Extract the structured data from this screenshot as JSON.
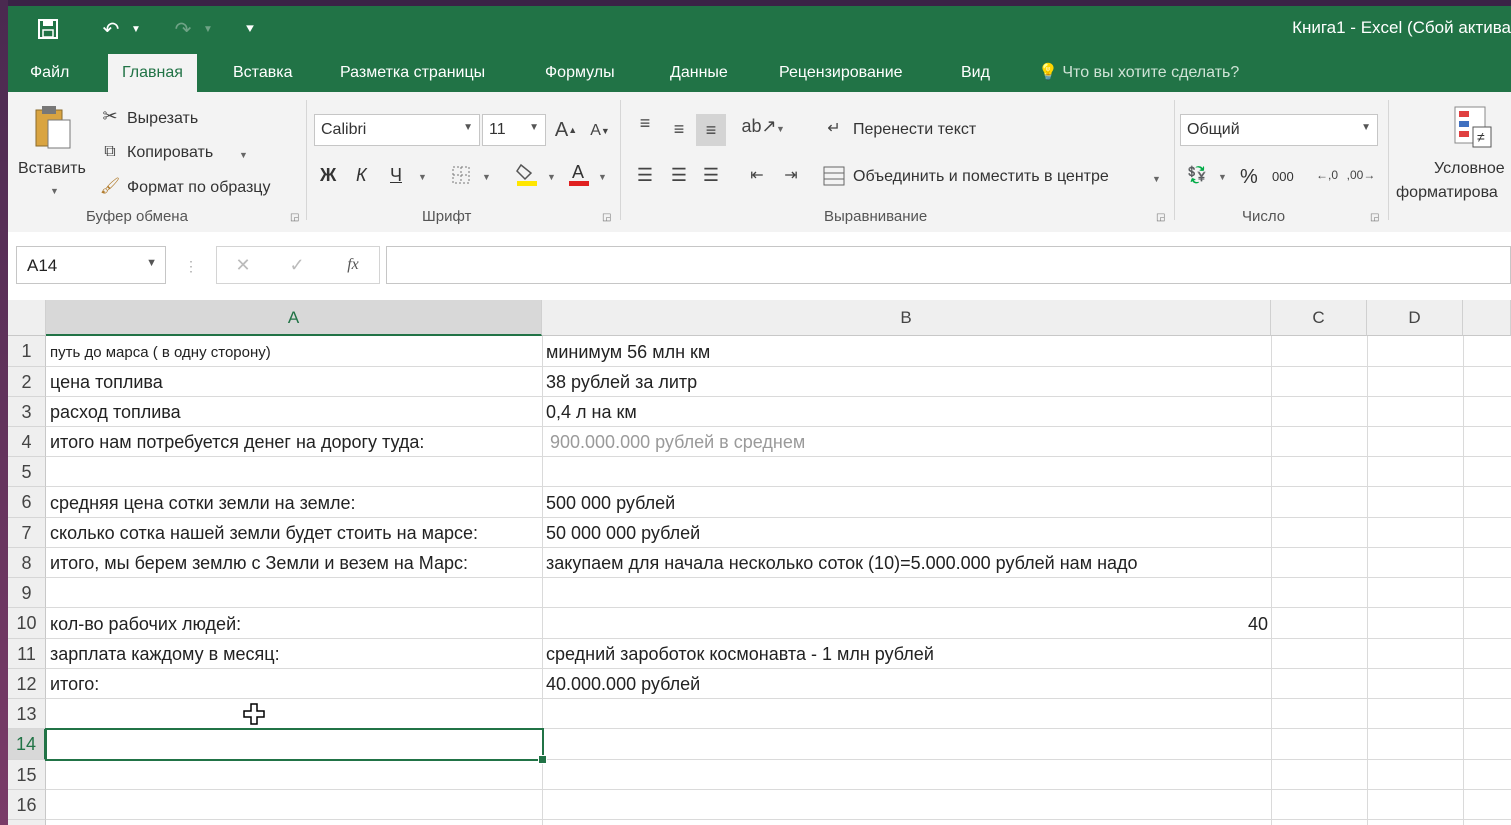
{
  "title": "Книга1 - Excel (Сбой актива",
  "tabs": [
    "Файл",
    "Главная",
    "Вставка",
    "Разметка страницы",
    "Формулы",
    "Данные",
    "Рецензирование",
    "Вид"
  ],
  "tell_me": "Что вы хотите сделать?",
  "clipboard": {
    "paste": "Вставить",
    "cut": "Вырезать",
    "copy": "Копировать",
    "format_painter": "Формат по образцу",
    "group": "Буфер обмена"
  },
  "font": {
    "name": "Calibri",
    "size": "11",
    "bold": "Ж",
    "italic": "К",
    "underline": "Ч",
    "group": "Шрифт"
  },
  "alignment": {
    "wrap": "Перенести текст",
    "merge": "Объединить и поместить в центре",
    "group": "Выравнивание"
  },
  "number": {
    "format": "Общий",
    "percent": "%",
    "thousands": "000",
    "group": "Число"
  },
  "conditional": {
    "line1": "Условное",
    "line2": "форматирова"
  },
  "name_box": "A14",
  "columns": [
    "A",
    "B",
    "C",
    "D"
  ],
  "rows": [
    "1",
    "2",
    "3",
    "4",
    "5",
    "6",
    "7",
    "8",
    "9",
    "10",
    "11",
    "12",
    "13",
    "14",
    "15",
    "16"
  ],
  "cells": {
    "a1": "путь до марса ( в одну сторону)",
    "b1": "минимум 56 млн км",
    "a2": "цена топлива",
    "b2": "38 рублей за литр",
    "a3": "расход топлива",
    "b3": "0,4 л на км",
    "a4": "итого нам потребуется денег на дорогу туда:",
    "b4": "900.000.000 рублей в среднем",
    "a6": "средняя цена сотки земли на земле:",
    "b6": "500 000 рублей",
    "a7": "сколько сотка нашей земли будет стоить на марсе:",
    "b7": "50 000 000 рублей",
    "a8": "итого, мы берем землю с Земли и везем на Марс:",
    "b8": "закупаем для начала несколько соток (10)=5.000.000 рублей нам надо",
    "a10": "кол-во рабочих людей:",
    "b10": "40",
    "a11": "зарплата каждому в месяц:",
    "b11": "средний зароботок космонавта - 1 млн рублей",
    "a12": "итого:",
    "b12": "40.000.000 рублей"
  },
  "accent": "#217346"
}
